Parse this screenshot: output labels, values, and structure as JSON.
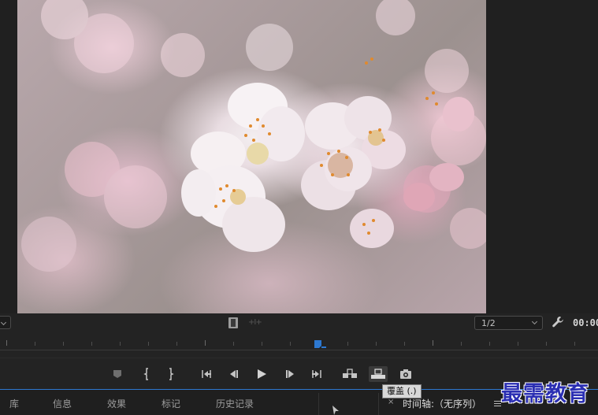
{
  "monitor": {
    "image_icon": "cherry-blossom-frame"
  },
  "controls": {
    "resolution": "1/2",
    "timecode": "00:00",
    "icons": [
      "film-icon",
      "trim-icon",
      "wrench-icon"
    ]
  },
  "transport": {
    "buttons": [
      {
        "name": "add-marker-button",
        "icon": "marker-icon"
      },
      {
        "name": "mark-in-button",
        "icon": "mark-in-icon",
        "glyph": "{"
      },
      {
        "name": "mark-out-button",
        "icon": "mark-out-icon",
        "glyph": "}"
      },
      {
        "name": "go-to-in-button",
        "icon": "go-to-in-icon"
      },
      {
        "name": "step-back-button",
        "icon": "step-back-icon"
      },
      {
        "name": "play-button",
        "icon": "play-icon"
      },
      {
        "name": "step-forward-button",
        "icon": "step-forward-icon"
      },
      {
        "name": "go-to-out-button",
        "icon": "go-to-out-icon"
      },
      {
        "name": "insert-button",
        "icon": "insert-icon"
      },
      {
        "name": "overwrite-button",
        "icon": "overwrite-icon"
      },
      {
        "name": "export-frame-button",
        "icon": "camera-icon"
      }
    ],
    "tooltip": "覆盖 (.)"
  },
  "panels": {
    "tabs": [
      "库",
      "信息",
      "效果",
      "标记",
      "历史记录"
    ],
    "timeline_tab": "时间轴:（无序列）"
  },
  "colors": {
    "accent": "#2d78d0",
    "background": "#232323"
  },
  "watermark": "最需教育"
}
